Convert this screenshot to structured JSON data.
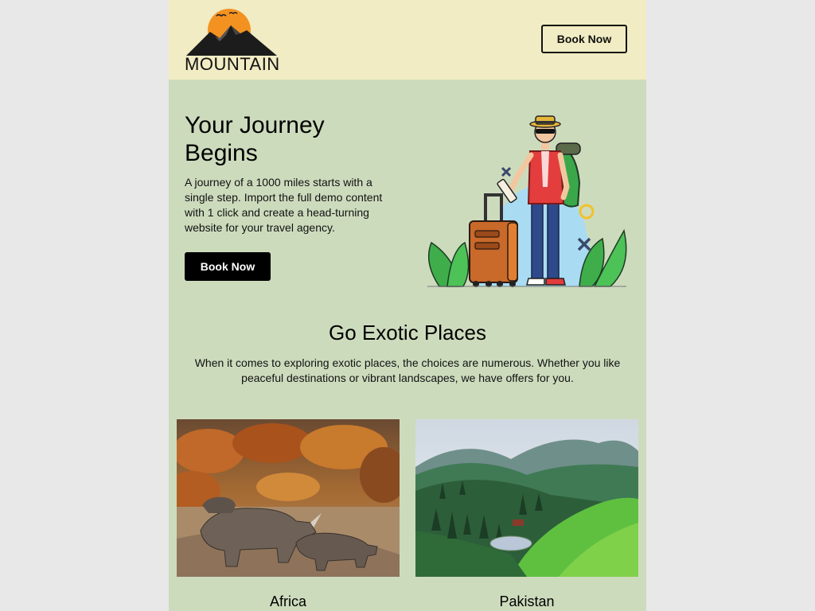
{
  "header": {
    "logo_text": "MOUNTAIN",
    "book_label": "Book Now"
  },
  "hero": {
    "title": "Your Journey Begins",
    "text": "A journey of a 1000 miles starts with a single step. Import the full demo content with 1 click and create a head-turning website for your travel agency.",
    "book_label": "Book Now"
  },
  "places": {
    "title": "Go Exotic Places",
    "text": "When it comes to exploring exotic places, the choices are numerous. Whether you like peaceful destinations or vibrant landscapes, we have offers for you.",
    "cards": [
      {
        "name": "Africa"
      },
      {
        "name": "Pakistan"
      }
    ]
  },
  "colors": {
    "header_bg": "#f1ecc3",
    "page_bg": "#cddbbd",
    "outer_bg": "#e8e8e8",
    "button_dark": "#000000",
    "logo_sun": "#f39221"
  }
}
